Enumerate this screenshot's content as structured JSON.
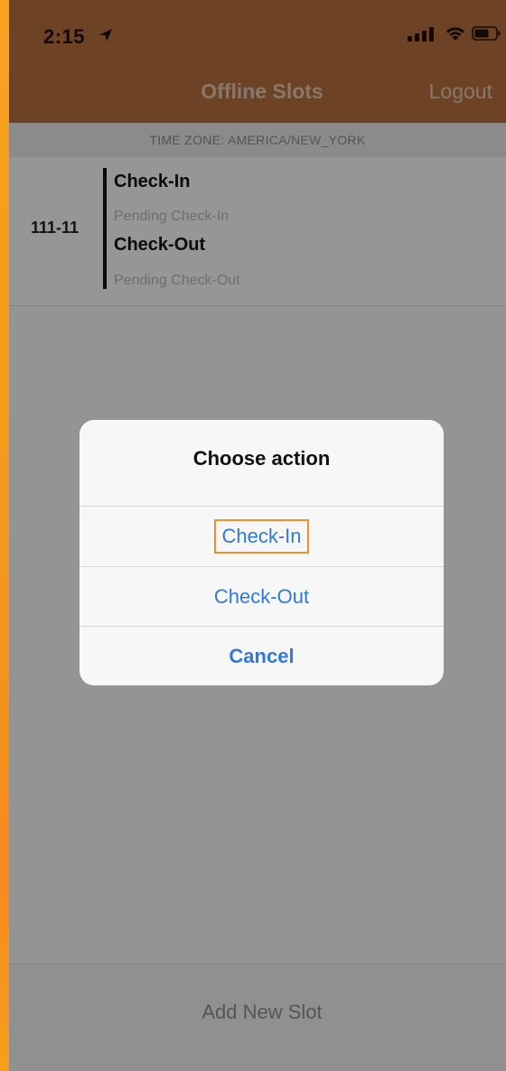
{
  "status_bar": {
    "time": "2:15",
    "icons": [
      "location-arrow-icon",
      "cellular-signal-icon",
      "wifi-icon",
      "battery-icon"
    ]
  },
  "nav": {
    "title": "Offline Slots",
    "logout_label": "Logout"
  },
  "timezone": "TIME ZONE: AMERICA/NEW_YORK",
  "slot": {
    "id": "111-11",
    "checkin_label": "Check-In",
    "checkin_status": "Pending Check-In",
    "checkout_label": "Check-Out",
    "checkout_status": "Pending Check-Out"
  },
  "footer": {
    "add_label": "Add New Slot"
  },
  "alert": {
    "title": "Choose action",
    "actions": [
      {
        "label": "Check-In",
        "highlighted": true
      },
      {
        "label": "Check-Out",
        "highlighted": false
      },
      {
        "label": "Cancel",
        "bold": true
      }
    ]
  },
  "colors": {
    "nav_background": "#b86f3e",
    "action_blue": "#2f7ad8",
    "highlight_outline": "#f08c2a",
    "frame_orange": "#f5a020"
  }
}
